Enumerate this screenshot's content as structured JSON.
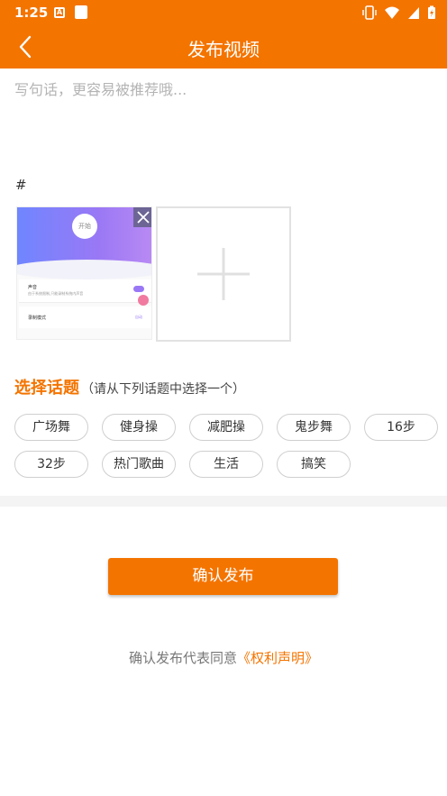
{
  "status_bar": {
    "time": "1:25",
    "left_icons": [
      "a-notification-icon",
      "square-notification-icon"
    ],
    "right_icons": [
      "vibrate-icon",
      "wifi-icon",
      "signal-icon",
      "battery-charging-icon"
    ]
  },
  "app_bar": {
    "title": "发布视频",
    "back_icon": "chevron-left-icon"
  },
  "post_input": {
    "placeholder": "写句话，更容易被推荐哦...",
    "value": ""
  },
  "hashtag_symbol": "#",
  "video_thumbnail": {
    "start_label": "开始",
    "row1_title": "声音",
    "row1_sub": "由于系统限制,只能录制系统内声音",
    "row2_title": "录制模式",
    "row2_value": "自动"
  },
  "topics": {
    "title": "选择话题",
    "hint": "（请从下列话题中选择一个）",
    "items": [
      "广场舞",
      "健身操",
      "减肥操",
      "鬼步舞",
      "16步",
      "32步",
      "热门歌曲",
      "生活",
      "搞笑"
    ]
  },
  "confirm_button": "确认发布",
  "agreement": {
    "prefix": "确认发布代表同意",
    "link": "《权利声明》"
  },
  "colors": {
    "brand": "#f47400",
    "tag_border": "#cfcfcf",
    "placeholder": "#b4b4b4"
  }
}
